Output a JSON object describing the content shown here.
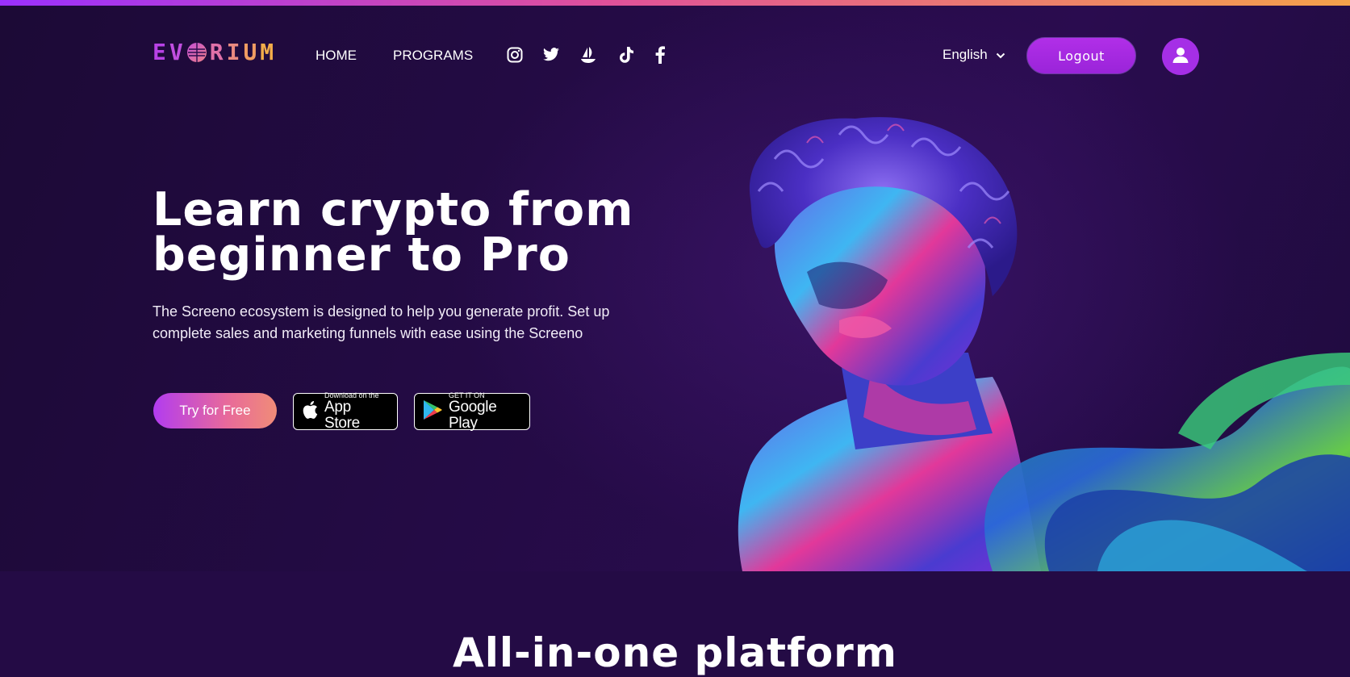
{
  "brand": {
    "letters": [
      "E",
      "V",
      "O",
      "R",
      "I",
      "U",
      "M"
    ],
    "colors": [
      "#b842e6",
      "#c04ee0",
      "#d05ec8",
      "#e070a8",
      "#ea8a80",
      "#f09c62",
      "#f3ad4a"
    ]
  },
  "nav": {
    "home": "HOME",
    "programs": "PROGRAMS"
  },
  "social": [
    {
      "icon": "instagram-icon"
    },
    {
      "icon": "twitter-icon"
    },
    {
      "icon": "opensea-icon"
    },
    {
      "icon": "tiktok-icon"
    },
    {
      "icon": "facebook-icon"
    }
  ],
  "language": {
    "selected": "English"
  },
  "auth": {
    "logout_label": "Logout",
    "avatar_icon": "user-icon"
  },
  "hero": {
    "title_line1": "Learn crypto from",
    "title_line2": "beginner to Pro",
    "subtitle_line1": "The Screeno ecosystem is designed to help you generate profit. Set up",
    "subtitle_line2": "complete sales and marketing funnels with ease using the Screeno",
    "cta_label": "Try for Free",
    "app_store": {
      "small": "Download on the",
      "big": "App Store"
    },
    "google_play": {
      "small": "GET IT ON",
      "big": "Google Play"
    }
  },
  "section": {
    "title": "All-in-one platform"
  },
  "colors": {
    "accent": "#a52fe6",
    "background": "#1e0b3c"
  }
}
